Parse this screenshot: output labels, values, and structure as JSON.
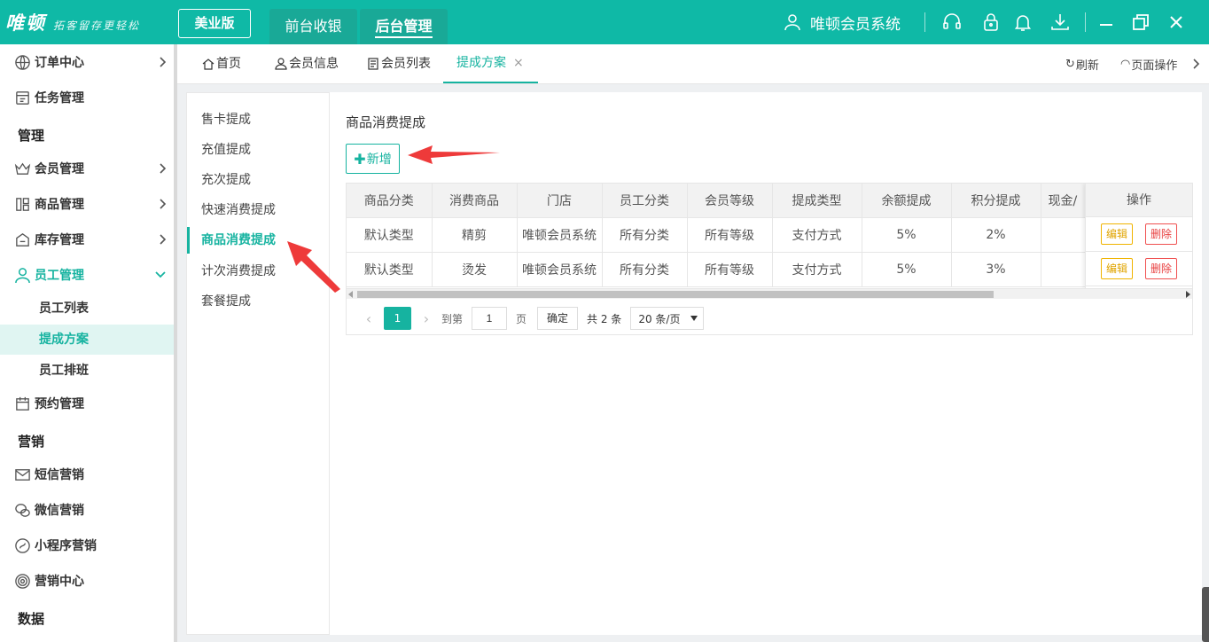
{
  "header": {
    "logo_main": "唯顿",
    "logo_slogan": "拓客留存更轻松",
    "edition": "美业版",
    "tabs": [
      {
        "label": "前台收银"
      },
      {
        "label": "后台管理"
      }
    ],
    "system_name": "唯顿会员系统",
    "accent_color": "#0fb9a6"
  },
  "sidebar": {
    "items": [
      {
        "label": "订单中心",
        "icon": "globe-icon"
      },
      {
        "label": "任务管理",
        "icon": "task-icon"
      },
      {
        "group": "管理"
      },
      {
        "label": "会员管理",
        "icon": "crown-icon"
      },
      {
        "label": "商品管理",
        "icon": "grid-icon"
      },
      {
        "label": "库存管理",
        "icon": "inventory-icon"
      },
      {
        "label": "员工管理",
        "icon": "person-icon"
      },
      {
        "sub": "员工列表"
      },
      {
        "sub": "提成方案"
      },
      {
        "sub": "员工排班"
      },
      {
        "label": "预约管理",
        "icon": "calendar-icon"
      },
      {
        "group": "营销"
      },
      {
        "label": "短信营销",
        "icon": "mail-icon"
      },
      {
        "label": "微信营销",
        "icon": "wechat-icon"
      },
      {
        "label": "小程序营销",
        "icon": "miniapp-icon"
      },
      {
        "label": "营销中心",
        "icon": "target-icon"
      },
      {
        "group": "数据"
      }
    ]
  },
  "page_tabs": {
    "items": [
      {
        "label": "首页",
        "icon": "home-icon"
      },
      {
        "label": "会员信息",
        "icon": "user-icon"
      },
      {
        "label": "会员列表",
        "icon": "list-icon"
      },
      {
        "label": "提成方案",
        "close": "×"
      }
    ],
    "refresh": "刷新",
    "page_ops": "页面操作"
  },
  "submenu": {
    "items": [
      "售卡提成",
      "充值提成",
      "充次提成",
      "快速消费提成",
      "商品消费提成",
      "计次消费提成",
      "套餐提成"
    ],
    "active": "商品消费提成"
  },
  "main": {
    "title": "商品消费提成",
    "add_button": "新增",
    "add_plus": "✚",
    "table": {
      "columns": [
        "商品分类",
        "消费商品",
        "门店",
        "员工分类",
        "会员等级",
        "提成类型",
        "余额提成",
        "积分提成",
        "现金/"
      ],
      "ops_header": "操作",
      "rows": [
        [
          "默认类型",
          "精剪",
          "唯顿会员系统",
          "所有分类",
          "所有等级",
          "支付方式",
          "5%",
          "2%",
          ""
        ],
        [
          "默认类型",
          "烫发",
          "唯顿会员系统",
          "所有分类",
          "所有等级",
          "支付方式",
          "5%",
          "3%",
          ""
        ]
      ],
      "edit_label": "编辑",
      "delete_label": "删除"
    },
    "pager": {
      "current": "1",
      "goto_label": "到第",
      "page_input": "1",
      "page_unit": "页",
      "confirm": "确定",
      "total": "共 2 条",
      "page_size": "20 条/页",
      "prev": "‹",
      "next": "›"
    }
  }
}
